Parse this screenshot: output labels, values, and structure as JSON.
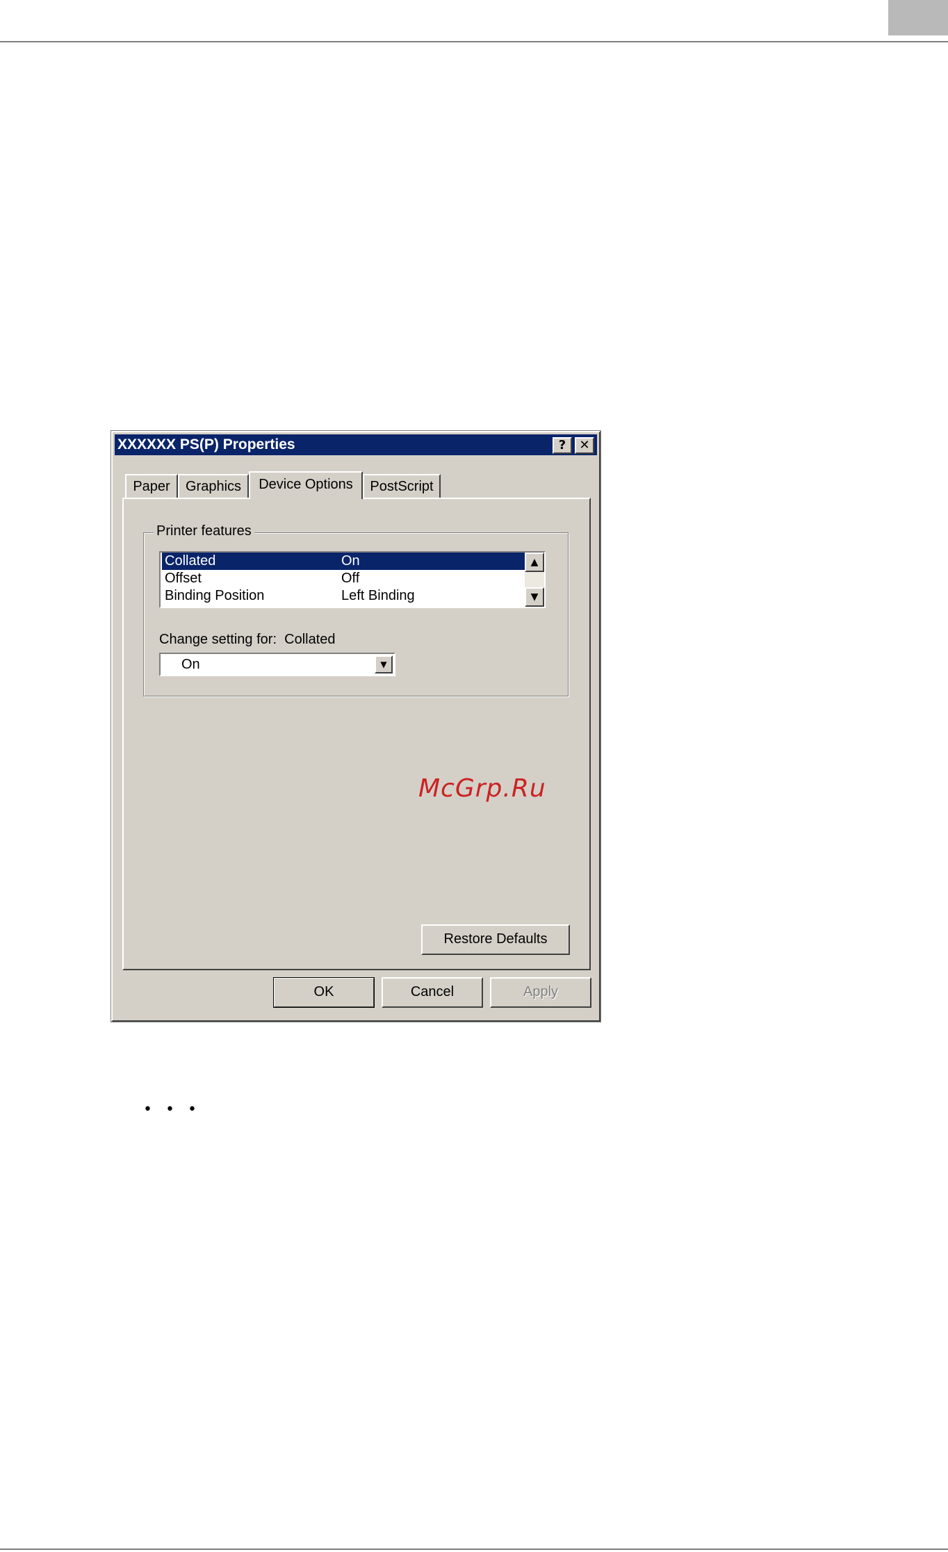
{
  "dialog": {
    "title": "XXXXXX PS(P) Properties",
    "help_symbol": "?",
    "close_symbol": "✕",
    "tabs": [
      {
        "label": "Paper"
      },
      {
        "label": "Graphics"
      },
      {
        "label": "Device Options",
        "active": true
      },
      {
        "label": "PostScript"
      }
    ],
    "group_label": "Printer features",
    "features": [
      {
        "name": "Collated",
        "value": "On",
        "selected": true
      },
      {
        "name": "Offset",
        "value": "Off"
      },
      {
        "name": "Binding Position",
        "value": "Left Binding"
      }
    ],
    "change_setting_label": "Change setting for:",
    "change_setting_target": "Collated",
    "combo_value": "On",
    "restore_defaults": "Restore Defaults",
    "ok": "OK",
    "cancel": "Cancel",
    "apply": "Apply"
  },
  "watermark": "McGrp.Ru",
  "page": {
    "bullets": "• • •"
  },
  "colors": {
    "titlebar": "#0a246a",
    "dialog_face": "#d4d0c8",
    "selection": "#0a246a",
    "watermark": "#cc2222"
  }
}
